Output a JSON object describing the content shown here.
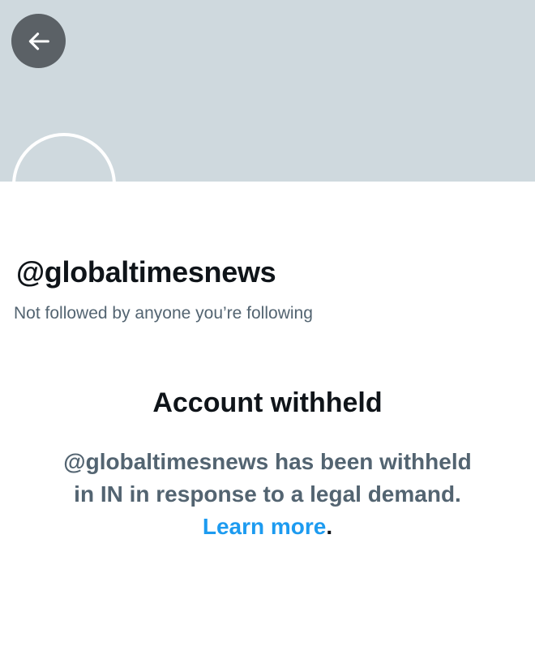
{
  "header": {
    "back_icon": "arrow-left-icon",
    "banner_color": "#cfd9de"
  },
  "profile": {
    "handle": "@globaltimesnews",
    "followed_by_text": "Not followed by anyone you’re following"
  },
  "withheld": {
    "title": "Account withheld",
    "message_line1": "@globaltimesnews has been withheld",
    "message_line2": "in IN in response to a legal demand.",
    "learn_more_label": "Learn more",
    "period": "."
  },
  "colors": {
    "accent": "#1d9bf0",
    "secondary_text": "#536471",
    "primary_text": "#0f1419"
  }
}
